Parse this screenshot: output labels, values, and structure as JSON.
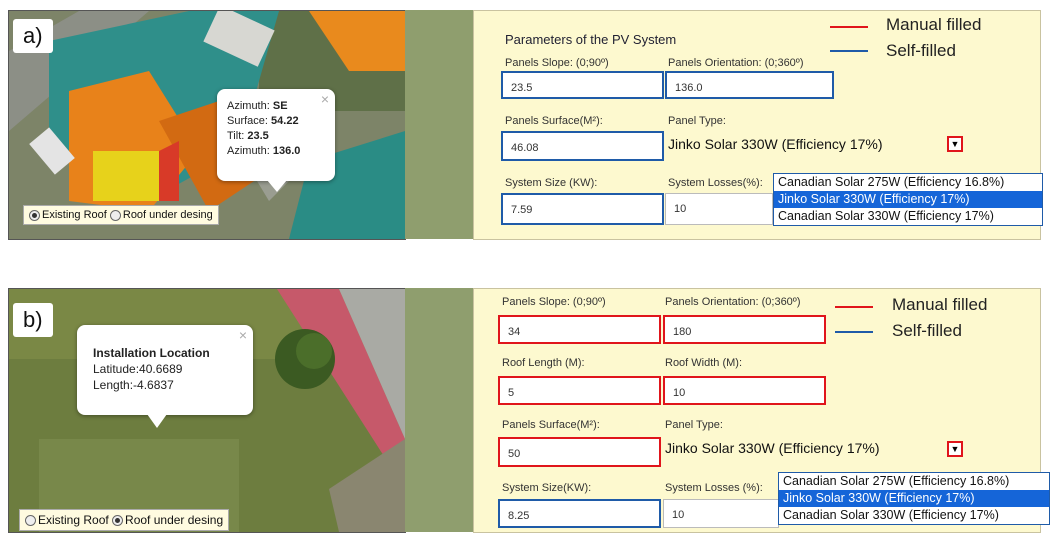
{
  "colors": {
    "manual": "#e0151b",
    "self": "#1f5ba8",
    "highlight": "#1565d8"
  },
  "a": {
    "tag": "a)",
    "popup": {
      "azimuth_label": "Azimuth:",
      "azimuth_dir": "SE",
      "surface_label": "Surface:",
      "surface_value": "54.22",
      "tilt_label": "Tilt:",
      "tilt_value": "23.5",
      "azimuth2_label": "Azimuth:",
      "azimuth2_value": "136.0",
      "close": "×"
    },
    "radios": {
      "opt1": "Existing Roof",
      "opt2": "Roof under desing",
      "selected": "opt1"
    },
    "form": {
      "title": "Parameters of the PV System",
      "slope_label": "Panels Slope: (0;90º)",
      "slope_value": "23.5",
      "orient_label": "Panels Orientation: (0;360º)",
      "orient_value": "136.0",
      "surface_label": "Panels Surface(M²):",
      "surface_value": "46.08",
      "type_label": "Panel Type:",
      "type_value": "Jinko Solar 330W (Efficiency 17%)",
      "size_label": "System Size (KW):",
      "size_value": "7.59",
      "losses_label": "System Losses(%):",
      "losses_value": "10",
      "dropdown_arrow": "▼"
    },
    "legend": {
      "manual": "Manual filled",
      "self": "Self-filled"
    },
    "options": [
      "Canadian Solar 275W (Efficiency 16.8%)",
      "Jinko Solar 330W (Efficiency 17%)",
      "Canadian Solar 330W (Efficiency 17%)"
    ]
  },
  "b": {
    "tag": "b)",
    "popup": {
      "title": "Installation Location",
      "lat": "Latitude:40.6689",
      "len": "Length:-4.6837",
      "close": "×"
    },
    "radios": {
      "opt1": "Existing Roof",
      "opt2": "Roof under desing",
      "selected": "opt2"
    },
    "form": {
      "slope_label": "Panels Slope: (0;90º)",
      "slope_value": "34",
      "orient_label": "Panels Orientation: (0;360º)",
      "orient_value": "180",
      "rlen_label": "Roof Length (M):",
      "rlen_value": "5",
      "rwid_label": "Roof Width (M):",
      "rwid_value": "10",
      "surface_label": "Panels Surface(M²):",
      "surface_value": "50",
      "type_label": "Panel Type:",
      "type_value": "Jinko Solar 330W (Efficiency 17%)",
      "size_label": "System Size(KW):",
      "size_value": "8.25",
      "losses_label": "System Losses (%):",
      "losses_value": "10",
      "dropdown_arrow": "▼"
    },
    "legend": {
      "manual": "Manual filled",
      "self": "Self-filled"
    },
    "options": [
      "Canadian Solar 275W (Efficiency 16.8%)",
      "Jinko Solar 330W (Efficiency 17%)",
      "Canadian Solar 330W (Efficiency 17%)"
    ]
  }
}
